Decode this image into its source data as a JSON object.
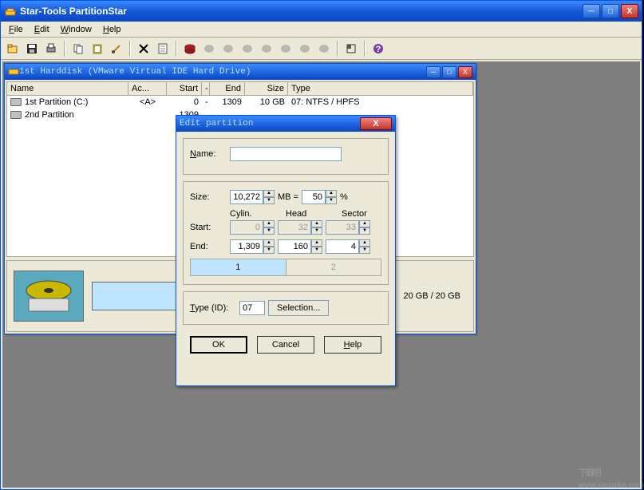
{
  "app": {
    "title": "Star-Tools PartitionStar"
  },
  "menu": {
    "file": "File",
    "edit": "Edit",
    "window": "Window",
    "help": "Help"
  },
  "child": {
    "title": "1st Harddisk (VMware Virtual IDE Hard Drive)",
    "columns": {
      "name": "Name",
      "ac": "Ac...",
      "start": "Start",
      "dot": "-",
      "end": "End",
      "size": "Size",
      "type": "Type"
    },
    "rows": [
      {
        "name": "1st Partition (C:)",
        "ac": "<A>",
        "start": "0",
        "dot": "-",
        "end": "1309",
        "size": "10 GB",
        "type": "07: NTFS / HPFS"
      },
      {
        "name": "2nd Partition",
        "ac": "",
        "start": "1309",
        "dot": "",
        "end": "",
        "size": "",
        "type": ""
      }
    ],
    "capacity": "20 GB / 20 GB"
  },
  "dialog": {
    "title": "Edit partition",
    "name_label": "Name:",
    "name_value": "",
    "size_label": "Size:",
    "size_value": "10,272",
    "size_unit": "MB   =",
    "size_pct": "50",
    "pct_sign": "%",
    "cylin": "Cylin.",
    "head": "Head",
    "sector": "Sector",
    "start_label": "Start:",
    "start_cyl": "0",
    "start_head": "32",
    "start_sec": "33",
    "end_label": "End:",
    "end_cyl": "1,309",
    "end_head": "160",
    "end_sec": "4",
    "seg1": "1",
    "seg2": "2",
    "type_label": "Type (ID):",
    "type_value": "07",
    "selection_btn": "Selection...",
    "ok": "OK",
    "cancel": "Cancel",
    "help": "Help"
  },
  "watermark": {
    "big": "下载吧",
    "small": "www.xiazaiba.com"
  }
}
